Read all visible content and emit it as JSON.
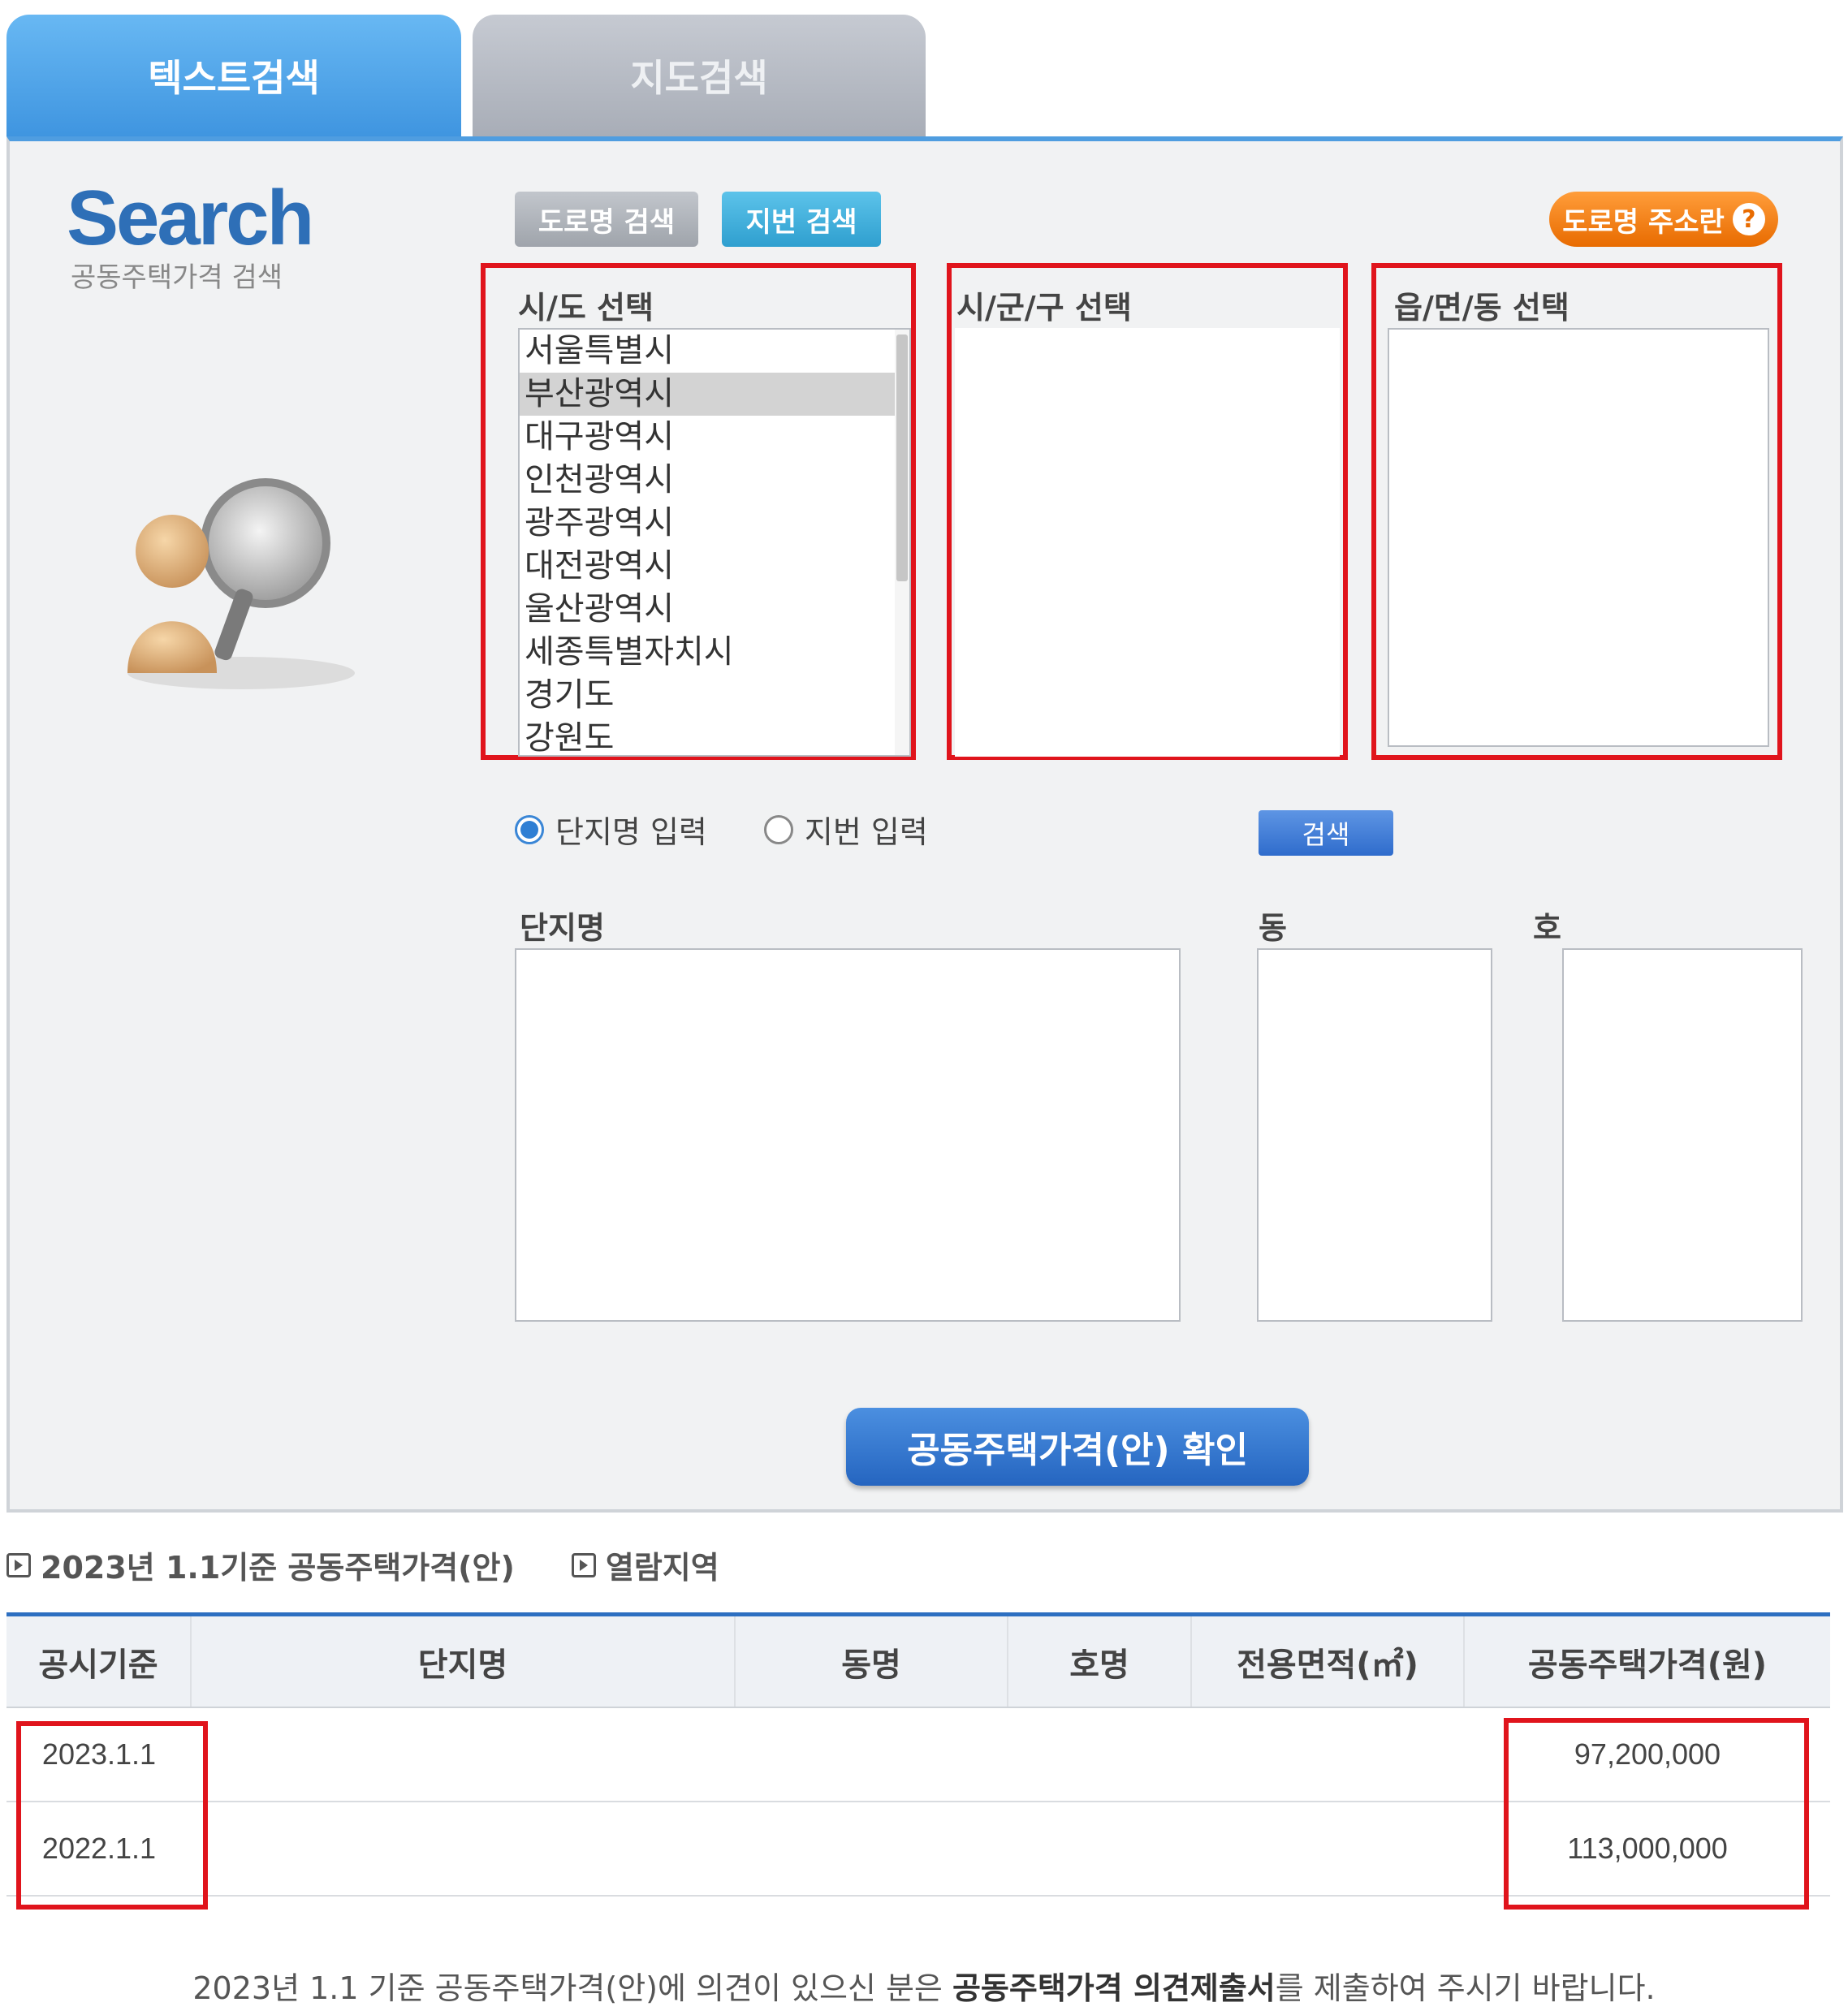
{
  "tabs": [
    {
      "label": "텍스트검색",
      "active": true
    },
    {
      "label": "지도검색",
      "active": false
    }
  ],
  "logo": {
    "title": "Search",
    "subtitle": "공동주택가격 검색"
  },
  "buttons": {
    "road_search": "도로명 검색",
    "jibun_search": "지번 검색",
    "road_guide": "도로명 주소란",
    "search": "검색",
    "confirm": "공동주택가격(안) 확인"
  },
  "regions": {
    "sido": {
      "label": "시/도 선택",
      "items": [
        "서울특별시",
        "부산광역시",
        "대구광역시",
        "인천광역시",
        "광주광역시",
        "대전광역시",
        "울산광역시",
        "세종특별자치시",
        "경기도",
        "강원도"
      ],
      "selected": "부산광역시"
    },
    "sigungu": {
      "label": "시/군/구 선택"
    },
    "eupmyeondong": {
      "label": "읍/면/동 선택"
    }
  },
  "input_mode": {
    "options": [
      "단지명 입력",
      "지번 입력"
    ],
    "selected": "단지명 입력"
  },
  "fields": {
    "complex": "단지명",
    "dong": "동",
    "ho": "호"
  },
  "results": {
    "heading": "2023년 1.1기준 공동주택가격(안)",
    "area_link": "열람지역",
    "columns": [
      "공시기준",
      "단지명",
      "동명",
      "호명",
      "전용면적(㎡)",
      "공동주택가격(원)"
    ],
    "rows": [
      {
        "date": "2023.1.1",
        "complex": "",
        "dong": "",
        "ho": "",
        "area": "",
        "price": "97,200,000"
      },
      {
        "date": "2022.1.1",
        "complex": "",
        "dong": "",
        "ho": "",
        "area": "",
        "price": "113,000,000"
      }
    ]
  },
  "notice": {
    "prefix": "2023년 1.1 기준 공동주택가격(안)에 의견이 있으신 분은 ",
    "bold": "공동주택가격 의견제출서",
    "suffix": "를 제출하여 주시기 바랍니다."
  },
  "colors": {
    "accent": "#2d6fc1",
    "highlight": "#e0141c",
    "guide": "#e86b00"
  }
}
